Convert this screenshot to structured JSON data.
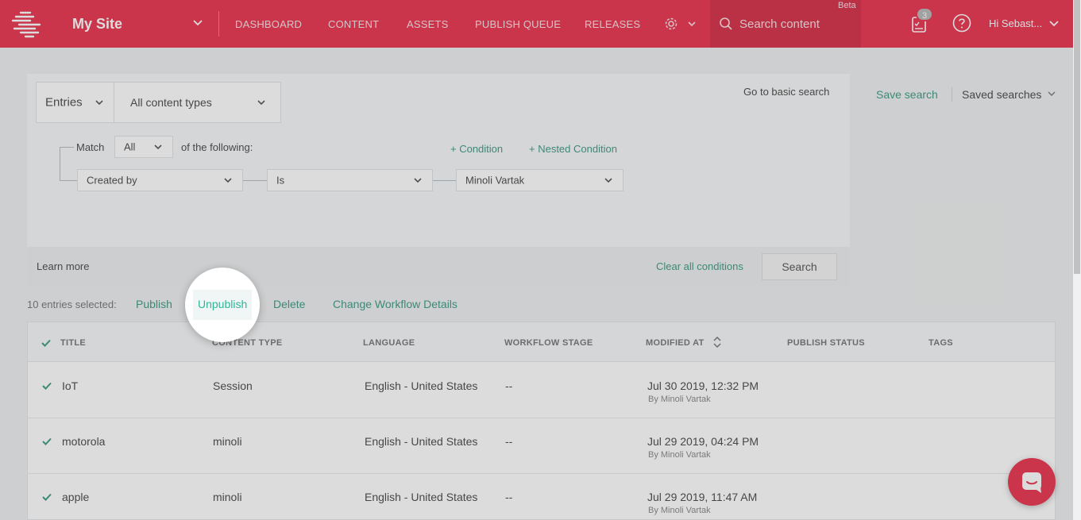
{
  "header": {
    "site_name": "My Site",
    "nav": [
      "DASHBOARD",
      "CONTENT",
      "ASSETS",
      "PUBLISH QUEUE",
      "RELEASES"
    ],
    "search_placeholder": "Search content",
    "beta_label": "Beta",
    "tasks_count": "3",
    "user_greeting": "Hi  Sebast..."
  },
  "search_panel": {
    "entries_select": "Entries",
    "content_types_select": "All content types",
    "basic_search_link": "Go to basic search",
    "match_label": "Match",
    "match_value": "All",
    "of_following": "of the following:",
    "add_condition": "+ Condition",
    "add_nested_condition": "+ Nested Condition",
    "condition": {
      "field": "Created by",
      "operator": "Is",
      "value": "Minoli Vartak"
    },
    "learn_more": "Learn more",
    "clear_all": "Clear all conditions",
    "search_button": "Search"
  },
  "saved": {
    "save_search": "Save search",
    "saved_searches": "Saved searches"
  },
  "bulk": {
    "count_text": "10 entries selected:",
    "publish": "Publish",
    "unpublish": "Unpublish",
    "delete": "Delete",
    "change_workflow": "Change Workflow Details"
  },
  "table": {
    "columns": [
      "TITLE",
      "CONTENT TYPE",
      "LANGUAGE",
      "WORKFLOW STAGE",
      "MODIFIED AT",
      "PUBLISH STATUS",
      "TAGS"
    ],
    "rows": [
      {
        "title": "IoT",
        "content_type": "Session",
        "language": "English - United States",
        "workflow": "--",
        "modified": "Jul 30 2019, 12:32 PM",
        "modified_by": "By Minoli Vartak"
      },
      {
        "title": "motorola",
        "content_type": "minoli",
        "language": "English - United States",
        "workflow": "--",
        "modified": "Jul 29 2019, 04:24 PM",
        "modified_by": "By Minoli Vartak"
      },
      {
        "title": "apple",
        "content_type": "minoli",
        "language": "English - United States",
        "workflow": "--",
        "modified": "Jul 29 2019, 11:47 AM",
        "modified_by": "By Minoli Vartak"
      }
    ]
  },
  "colors": {
    "brand": "#e9344f",
    "link": "#3e9a82"
  }
}
